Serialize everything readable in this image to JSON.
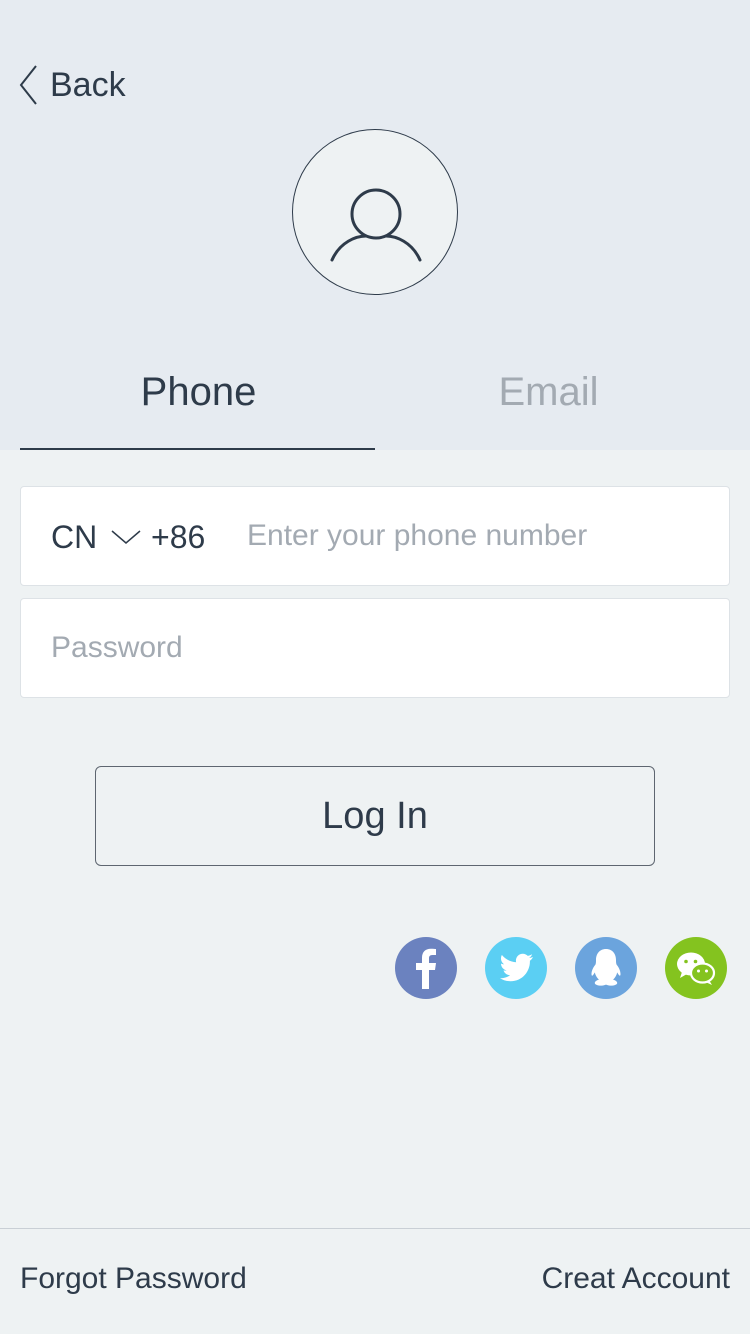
{
  "header": {
    "back_label": "Back"
  },
  "tabs": [
    {
      "label": "Phone",
      "active": true
    },
    {
      "label": "Email",
      "active": false
    }
  ],
  "phone_field": {
    "country_code": "CN",
    "dial_code": "+86",
    "placeholder": "Enter your phone number",
    "value": ""
  },
  "password_field": {
    "placeholder": "Password",
    "value": ""
  },
  "login_button": {
    "label": "Log In"
  },
  "social_logins": [
    {
      "icon": "facebook-icon",
      "color": "#6b82bf"
    },
    {
      "icon": "twitter-icon",
      "color": "#5bcff3"
    },
    {
      "icon": "qq-icon",
      "color": "#6ba4dd"
    },
    {
      "icon": "wechat-icon",
      "color": "#84c31f"
    }
  ],
  "footer": {
    "forgot_label": "Forgot Password",
    "create_label": "Creat Account"
  },
  "colors": {
    "header_bg": "#e6ebf1",
    "page_bg": "#eef2f3",
    "text": "#2e3b4a",
    "muted": "#a3aab2"
  }
}
